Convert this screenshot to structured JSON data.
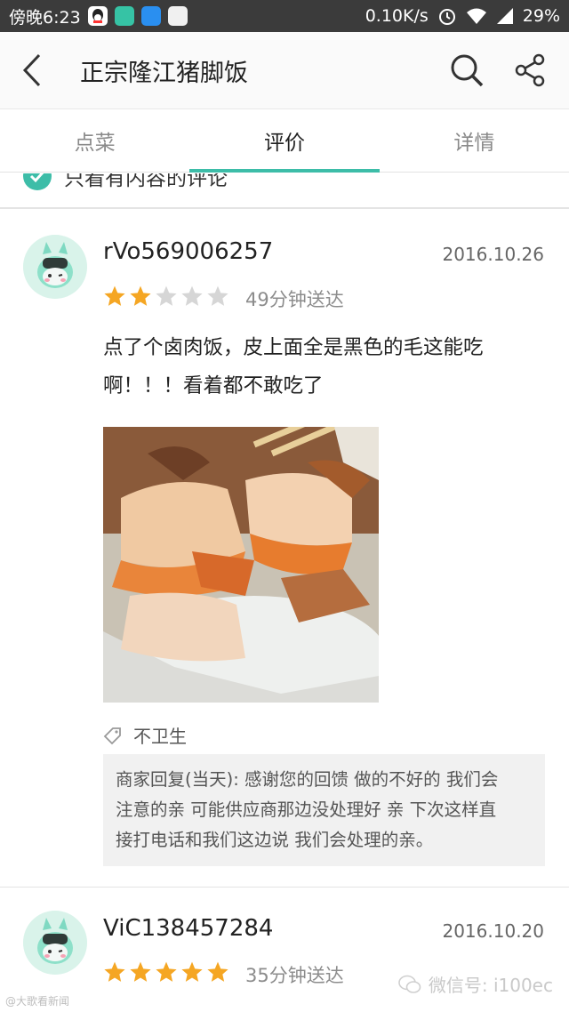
{
  "status_bar": {
    "time": "傍晚6:23",
    "network_speed": "0.10K/s",
    "battery": "29%"
  },
  "app_bar": {
    "title": "正宗隆江猪脚饭"
  },
  "tabs": [
    {
      "label": "点菜",
      "active": false
    },
    {
      "label": "评价",
      "active": true
    },
    {
      "label": "详情",
      "active": false
    }
  ],
  "filter": {
    "label": "只看有内容的评论",
    "checked": true
  },
  "reviews": [
    {
      "username": "rVo569006257",
      "date": "2016.10.26",
      "rating": 2,
      "max_rating": 5,
      "delivery": "49分钟送达",
      "text_lines": [
        "点了个卤肉饭，皮上面全是黑色的毛这能吃",
        "啊！！！看着都不敢吃了"
      ],
      "tag": "不卫生",
      "reply_lines": [
        "商家回复(当天): 感谢您的回馈 做的不好的 我们会",
        "注意的亲 可能供应商那边没处理好 亲 下次这样直",
        "接打电话和我们这边说 我们会处理的亲。"
      ]
    },
    {
      "username": "ViC138457284",
      "date": "2016.10.20",
      "rating": 5,
      "max_rating": 5,
      "delivery": "35分钟送达"
    }
  ],
  "watermark": {
    "right_text": "微信号: i100ec",
    "left_text": "@大歌看新闻"
  },
  "colors": {
    "accent": "#3dbda8",
    "star_on": "#f5a623",
    "star_off": "#d6d6d6",
    "status_bar": "#3b3b3b"
  }
}
